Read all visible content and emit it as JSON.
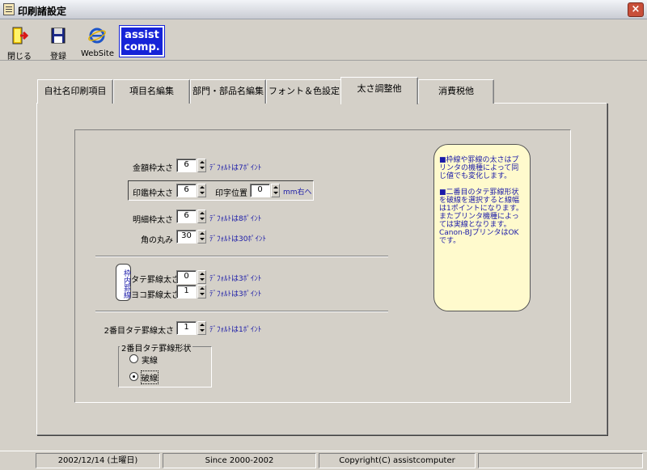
{
  "window": {
    "title": "印刷諸設定",
    "close_glyph": "×"
  },
  "toolbar": {
    "close_label": "閉じる",
    "save_label": "登録",
    "website_label": "WebSite",
    "logo_line1": "assist",
    "logo_line2": "comp."
  },
  "tabs": [
    {
      "label": "自社名印刷項目"
    },
    {
      "label": "項目名編集"
    },
    {
      "label": "部門・部品名編集"
    },
    {
      "label": "フォント＆色設定"
    },
    {
      "label": "太さ調整他",
      "active": true
    },
    {
      "label": "消費税他"
    }
  ],
  "settings": {
    "kingaku": {
      "label": "金額枠太さ",
      "value": "6",
      "note": "ﾃﾞﾌｫﾙﾄは7ﾎﾟｲﾝﾄ"
    },
    "inkan": {
      "label": "印鑑枠太さ",
      "value": "6",
      "pos_label": "印字位置",
      "pos_value": "0",
      "pos_unit": "mm右へ"
    },
    "meisai": {
      "label": "明細枠太さ",
      "value": "6",
      "note": "ﾃﾞﾌｫﾙﾄは8ﾎﾟｲﾝﾄ"
    },
    "kado": {
      "label": "角の丸み",
      "value": "30",
      "note": "ﾃﾞﾌｫﾙﾄは30ﾎﾟｲﾝﾄ"
    },
    "wakunai_label": "枠内罫線",
    "tate": {
      "label": "タテ罫線太さ",
      "value": "0",
      "note": "ﾃﾞﾌｫﾙﾄは3ﾎﾟｲﾝﾄ"
    },
    "yoko": {
      "label": "ヨコ罫線太さ",
      "value": "1",
      "note": "ﾃﾞﾌｫﾙﾄは3ﾎﾟｲﾝﾄ"
    },
    "second_tate": {
      "label": "2番目タテ罫線太さ",
      "value": "1",
      "note": "ﾃﾞﾌｫﾙﾄは1ﾎﾟｲﾝﾄ"
    },
    "shape_group": {
      "legend": "2番目タテ罫線形状",
      "options": [
        {
          "label": "実線",
          "selected": false
        },
        {
          "label": "破線",
          "selected": true
        }
      ]
    }
  },
  "info": {
    "para1": "■枠線や罫線の太さはプリンタの機種によって同じ値でも変化します。",
    "para2": "■二番目のタテ罫線形状を破線を選択すると線幅は1ポイントになります。またプリンタ機種によっては実線となります。Canon-BJプリンタはOKです。"
  },
  "status": {
    "date": "2002/12/14 (土曜日)",
    "since": "Since 2000-2002",
    "copyright": "Copyright(C) assistcomputer"
  },
  "colors": {
    "note_text": "#1a1aa8",
    "info_bg": "#fffacd",
    "logo_bg": "#1624d8"
  }
}
